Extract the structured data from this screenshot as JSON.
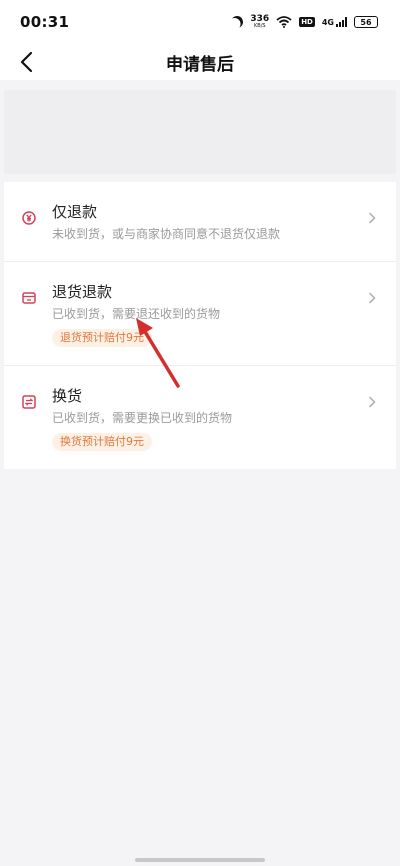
{
  "status_bar": {
    "time": "00:31",
    "net_speed_value": "336",
    "net_speed_unit": "KB/S",
    "hd": "HD",
    "signal": "4G",
    "battery": "56"
  },
  "header": {
    "title": "申请售后"
  },
  "options": [
    {
      "title": "仅退款",
      "desc": "未收到货，或与商家协商同意不退货仅退款",
      "tag": ""
    },
    {
      "title": "退货退款",
      "desc": "已收到货，需要退还收到的货物",
      "tag": "退货预计赔付9元"
    },
    {
      "title": "换货",
      "desc": "已收到货，需要更换已收到的货物",
      "tag": "换货预计赔付9元"
    }
  ],
  "colors": {
    "accent": "#d8405a",
    "tag_text": "#e0783b",
    "tag_bg": "#fdf1e6",
    "annotation_arrow": "#d32f2f"
  },
  "icons": {
    "back": "chevron-left-icon",
    "refund_only": "yen-circle-icon",
    "return_refund": "return-box-icon",
    "exchange": "exchange-icon",
    "row_chevron": "chevron-right-icon"
  }
}
